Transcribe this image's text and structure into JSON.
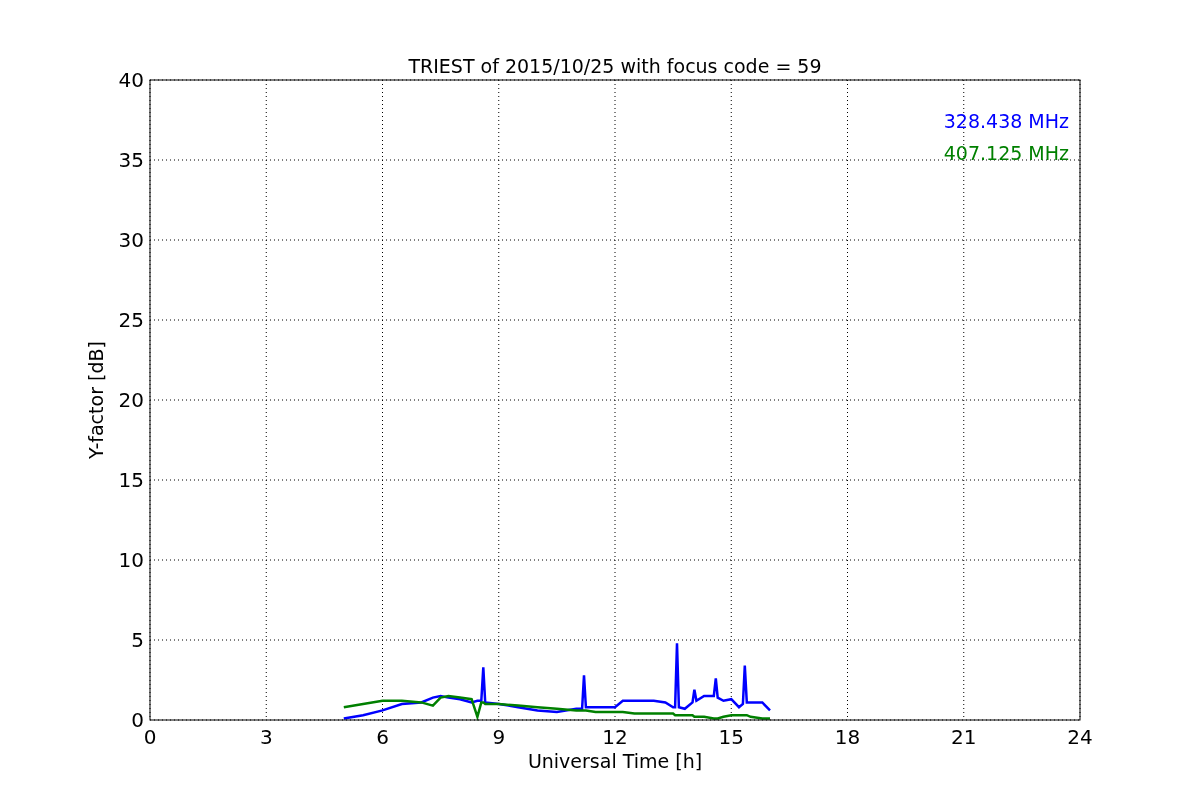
{
  "chart_data": {
    "type": "line",
    "title": "TRIEST of 2015/10/25 with focus code = 59",
    "xlabel": "Universal Time [h]",
    "ylabel": "Y-factor [dB]",
    "grid": true,
    "xlim": [
      0,
      24
    ],
    "ylim": [
      0,
      40
    ],
    "xticks": [
      0,
      3,
      6,
      9,
      12,
      15,
      18,
      21,
      24
    ],
    "yticks": [
      0,
      5,
      10,
      15,
      20,
      25,
      30,
      35,
      40
    ],
    "x": [
      5,
      5.5,
      6,
      6.5,
      7,
      7.3,
      7.5,
      7.7,
      8,
      8.3,
      8.45,
      8.55,
      8.6,
      8.65,
      9,
      9.5,
      10,
      10.5,
      11,
      11.15,
      11.2,
      11.25,
      11.5,
      12,
      12.2,
      12.5,
      13,
      13.3,
      13.5,
      13.55,
      13.6,
      13.65,
      13.8,
      14,
      14.05,
      14.1,
      14.3,
      14.55,
      14.6,
      14.65,
      14.8,
      15,
      15.2,
      15.3,
      15.35,
      15.4,
      15.5,
      15.8,
      16
    ],
    "series": [
      {
        "name": "328.438 MHz",
        "color": "#0000ff",
        "values": [
          0.1,
          0.3,
          0.6,
          1.0,
          1.1,
          1.4,
          1.5,
          1.4,
          1.3,
          1.1,
          1.2,
          1.2,
          3.3,
          1.1,
          1.0,
          0.8,
          0.6,
          0.5,
          0.7,
          0.7,
          2.8,
          0.8,
          0.8,
          0.8,
          1.2,
          1.2,
          1.2,
          1.1,
          0.8,
          0.8,
          4.8,
          0.8,
          0.7,
          1.1,
          1.9,
          1.2,
          1.5,
          1.5,
          2.6,
          1.4,
          1.2,
          1.3,
          0.8,
          1.0,
          3.4,
          1.1,
          1.1,
          1.1,
          0.6
        ]
      },
      {
        "name": "407.125 MHz",
        "color": "#008000",
        "values": [
          0.8,
          1.0,
          1.2,
          1.2,
          1.1,
          0.9,
          1.4,
          1.5,
          1.4,
          1.3,
          0.2,
          1.1,
          1.1,
          1.0,
          1.0,
          0.9,
          0.8,
          0.7,
          0.6,
          0.6,
          0.6,
          0.6,
          0.5,
          0.5,
          0.5,
          0.4,
          0.4,
          0.4,
          0.4,
          0.3,
          0.3,
          0.3,
          0.3,
          0.3,
          0.2,
          0.2,
          0.2,
          0.1,
          0.1,
          0.1,
          0.2,
          0.3,
          0.3,
          0.3,
          0.3,
          0.3,
          0.2,
          0.1,
          0.1
        ]
      }
    ]
  }
}
